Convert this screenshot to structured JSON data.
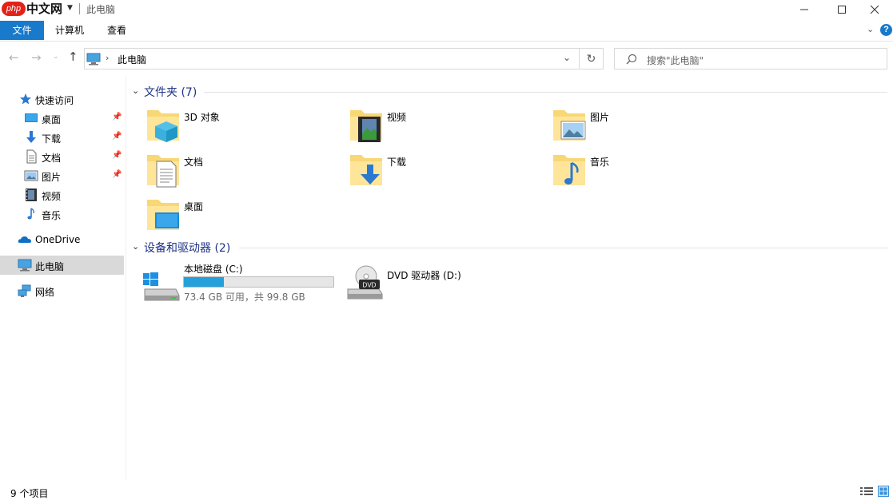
{
  "window": {
    "logo_php": "php",
    "logo_site": "中文网",
    "title": "此电脑"
  },
  "ribbon": {
    "tabs": [
      {
        "label": "文件"
      },
      {
        "label": "计算机"
      },
      {
        "label": "查看"
      }
    ],
    "help_label": "?"
  },
  "address": {
    "crumb": "此电脑",
    "search_placeholder": "搜索\"此电脑\""
  },
  "sidebar": {
    "quick_access": "快速访问",
    "quick_items": [
      {
        "label": "桌面",
        "icon": "desktop-icon"
      },
      {
        "label": "下载",
        "icon": "download-icon"
      },
      {
        "label": "文档",
        "icon": "documents-icon"
      },
      {
        "label": "图片",
        "icon": "pictures-icon"
      },
      {
        "label": "视频",
        "icon": "video-icon"
      },
      {
        "label": "音乐",
        "icon": "music-icon"
      }
    ],
    "onedrive": "OneDrive",
    "this_pc": "此电脑",
    "network": "网络"
  },
  "folders_group": {
    "title": "文件夹 (7)",
    "items": [
      {
        "label": "3D 对象",
        "icon": "3d-objects-folder-icon"
      },
      {
        "label": "视频",
        "icon": "videos-folder-icon"
      },
      {
        "label": "图片",
        "icon": "pictures-folder-icon"
      },
      {
        "label": "文档",
        "icon": "documents-folder-icon"
      },
      {
        "label": "下载",
        "icon": "downloads-folder-icon"
      },
      {
        "label": "音乐",
        "icon": "music-folder-icon"
      },
      {
        "label": "桌面",
        "icon": "desktop-folder-icon"
      }
    ]
  },
  "devices_group": {
    "title": "设备和驱动器 (2)",
    "drives": [
      {
        "label": "本地磁盘 (C:)",
        "detail": "73.4 GB 可用，共 99.8 GB",
        "used_fraction": 0.265
      },
      {
        "label": "DVD 驱动器 (D:)",
        "badge": "DVD"
      }
    ]
  },
  "status": {
    "count": "9 个项目"
  },
  "colors": {
    "accent": "#1979ca",
    "group_title": "#1e3287",
    "drive_bar": "#26a0da",
    "folder": "#f8d775"
  }
}
